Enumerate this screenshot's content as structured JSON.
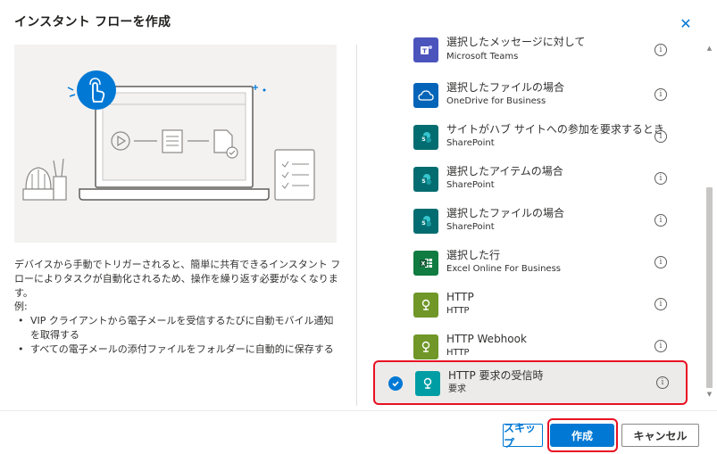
{
  "dialog": {
    "title": "インスタント フローを作成",
    "close_glyph": "✕"
  },
  "description": {
    "text": "デバイスから手動でトリガーされると、簡単に共有できるインスタント フローによりタスクが自動化されるため、操作を繰り返す必要がなくなります。",
    "example_heading": "例:",
    "examples": [
      "VIP クライアントから電子メールを受信するたびに自動モバイル通知を取得する",
      "すべての電子メールの添付ファイルをフォルダーに自動的に保存する"
    ]
  },
  "triggers": [
    {
      "name": "選択したメッセージに対して",
      "connector": "Microsoft Teams",
      "icon": "teams-icon",
      "color": "#4b53bc",
      "selected": false
    },
    {
      "name": "選択したファイルの場合",
      "connector": "OneDrive for Business",
      "icon": "onedrive-icon",
      "color": "#0364b8",
      "selected": false
    },
    {
      "name": "サイトがハブ サイトへの参加を要求するとき",
      "connector": "SharePoint",
      "icon": "sharepoint-icon",
      "color": "#036c70",
      "selected": false
    },
    {
      "name": "選択したアイテムの場合",
      "connector": "SharePoint",
      "icon": "sharepoint-icon",
      "color": "#036c70",
      "selected": false
    },
    {
      "name": "選択したファイルの場合",
      "connector": "SharePoint",
      "icon": "sharepoint-icon",
      "color": "#036c70",
      "selected": false
    },
    {
      "name": "選択した行",
      "connector": "Excel Online For Business",
      "icon": "excel-icon",
      "color": "#107c41",
      "selected": false
    },
    {
      "name": "HTTP",
      "connector": "HTTP",
      "icon": "http-icon",
      "color": "#709727",
      "selected": false
    },
    {
      "name": "HTTP Webhook",
      "connector": "HTTP",
      "icon": "http-icon",
      "color": "#709727",
      "selected": false
    },
    {
      "name": "HTTP 要求の受信時",
      "connector": "要求",
      "icon": "request-icon",
      "color": "#009da5",
      "selected": true
    }
  ],
  "info_glyph": "i",
  "buttons": {
    "skip": "スキップ",
    "create": "作成",
    "cancel": "キャンセル"
  },
  "colors": {
    "accent": "#0078d4",
    "highlight": "#e81123"
  }
}
